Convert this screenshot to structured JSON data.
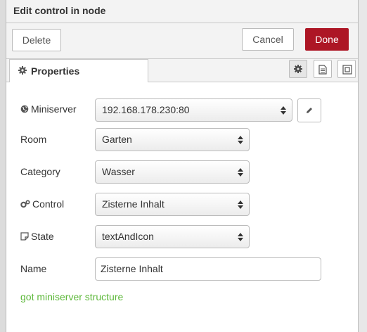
{
  "header": {
    "title": "Edit control in node"
  },
  "buttons": {
    "delete": "Delete",
    "cancel": "Cancel",
    "done": "Done"
  },
  "tabs": [
    {
      "label": "Properties",
      "icon": "gear-icon"
    }
  ],
  "tab_icons": [
    "gear-icon",
    "description-icon",
    "appearance-icon"
  ],
  "fields": {
    "miniserver": {
      "label": "Miniserver",
      "icon": "globe-icon",
      "value": "192.168.178.230:80"
    },
    "room": {
      "label": "Room",
      "value": "Garten"
    },
    "category": {
      "label": "Category",
      "value": "Wasser"
    },
    "control": {
      "label": "Control",
      "icon": "cogs-icon",
      "value": "Zisterne Inhalt"
    },
    "state": {
      "label": "State",
      "icon": "sticky-note-icon",
      "value": "textAndIcon"
    },
    "name": {
      "label": "Name",
      "value": "Zisterne Inhalt"
    }
  },
  "status": "got miniserver structure",
  "colors": {
    "done_button": "#ad1625",
    "status_text": "#5db83a"
  }
}
